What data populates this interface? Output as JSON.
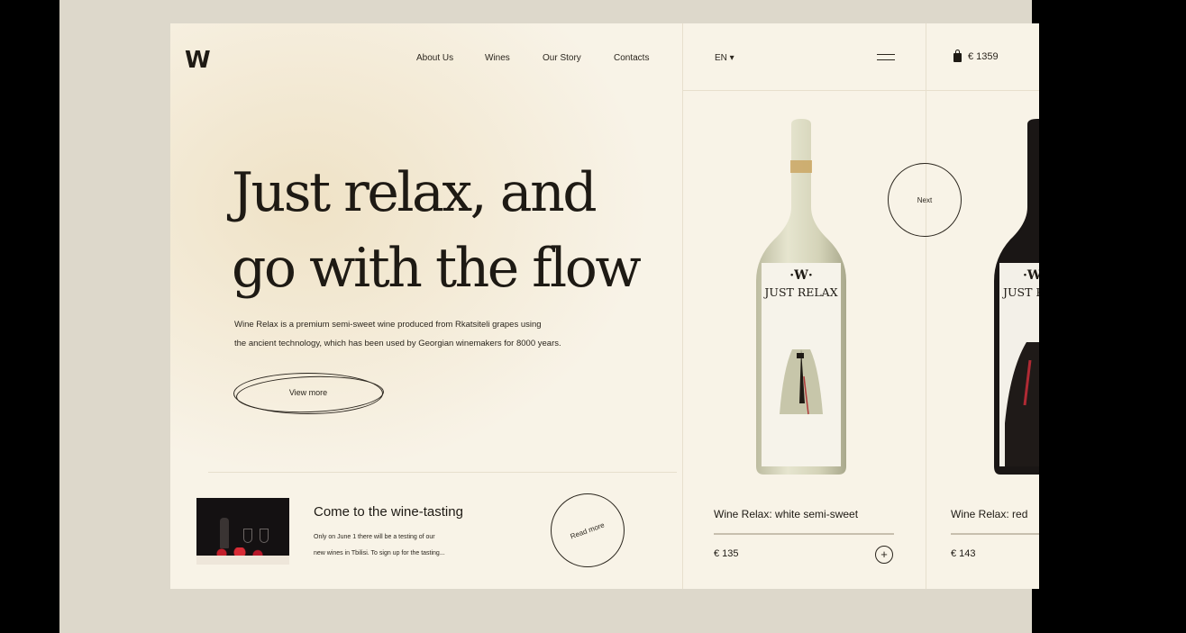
{
  "header": {
    "logo": "W",
    "nav": [
      "About Us",
      "Wines",
      "Our Story",
      "Contacts"
    ],
    "language": "EN ▾",
    "cart_total": "€ 1359"
  },
  "hero": {
    "title_line1": "Just relax, and",
    "title_line2": "go with the flow",
    "text_line1": "Wine Relax is a premium semi-sweet wine produced from Rkatsiteli grapes using",
    "text_line2": "the ancient technology, which has been used by Georgian winemakers for 8000 years.",
    "button": "View more"
  },
  "event": {
    "title": "Come to the wine-tasting",
    "text_line1": "Only on June 1 there will be a testing of our",
    "text_line2": "new wines in Tbilisi. To sign up for the tasting...",
    "button": "Read more"
  },
  "carousel": {
    "next": "Next"
  },
  "products": [
    {
      "name": "Wine Relax: white semi-sweet",
      "price": "€ 135",
      "add": "+",
      "label_logo": "·W·",
      "label_title": "JUST RELAX"
    },
    {
      "name": "Wine Relax: red",
      "price": "€ 143",
      "label_logo": "·W",
      "label_title": "JUST R"
    }
  ],
  "colors": {
    "page_background": "#f8f3e7",
    "outer_background": "#ddd8cb",
    "ink": "#1e1a14",
    "white_wine": "#d9d8bf",
    "red_wine": "#1a1615"
  }
}
